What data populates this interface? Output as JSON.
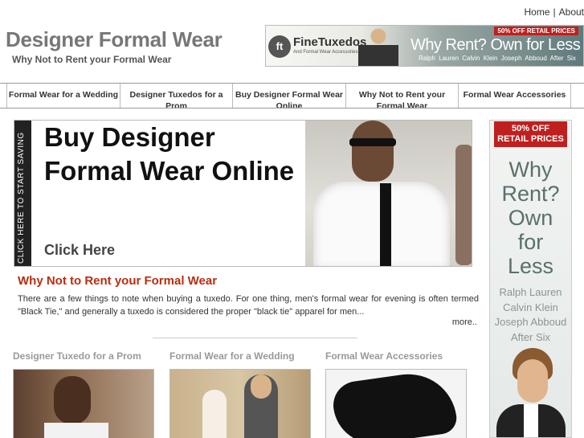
{
  "toplinks": {
    "home": "Home",
    "separator": "|",
    "about": "About"
  },
  "site": {
    "title": "Designer Formal Wear",
    "tagline": "Why Not to Rent your Formal Wear"
  },
  "header_banner": {
    "logo_mark": "ft",
    "logo_text": "FineTuxedos",
    "logo_subtext": "And Formal Wear Accessories",
    "badge": "50% OFF RETAIL PRICES",
    "headline": "Why Rent? Own for Less",
    "brands": "Ralph Lauren  Calvin Klein  Joseph Abboud  After Six"
  },
  "nav": {
    "items": [
      {
        "label": "Formal Wear for a Wedding"
      },
      {
        "label": "Designer Tuxedos for a Prom"
      },
      {
        "label": "Buy Designer Formal Wear Online"
      },
      {
        "label": "Why Not to Rent your Formal Wear"
      },
      {
        "label": "Formal Wear Accessories"
      }
    ]
  },
  "hero": {
    "side_tab": "CLICK HERE TO START SAVING",
    "title": "Buy Designer Formal Wear Online",
    "cta": "Click Here"
  },
  "article": {
    "title": "Why Not to Rent your Formal Wear",
    "body": "There are a few things to note when buying a tuxedo. For one thing, men's formal wear for evening is often termed \"Black Tie,\" and generally a tuxedo is considered the proper \"black tie\" apparel for men...",
    "more": "more.."
  },
  "categories": [
    {
      "title": "Designer Tuxedo for a Prom"
    },
    {
      "title": "Formal Wear for a Wedding"
    },
    {
      "title": "Formal Wear Accessories"
    }
  ],
  "side_ad": {
    "badge_line1": "50% OFF",
    "badge_line2": "RETAIL PRICES",
    "headline": [
      "Why",
      "Rent?",
      "Own",
      "for",
      "Less"
    ],
    "brands": [
      "Ralph Lauren",
      "Calvin Klein",
      "Joseph Abboud",
      "After Six"
    ]
  },
  "colors": {
    "accent_red": "#b92d10",
    "badge_red": "#c01f1f",
    "title_gray": "#777777"
  }
}
